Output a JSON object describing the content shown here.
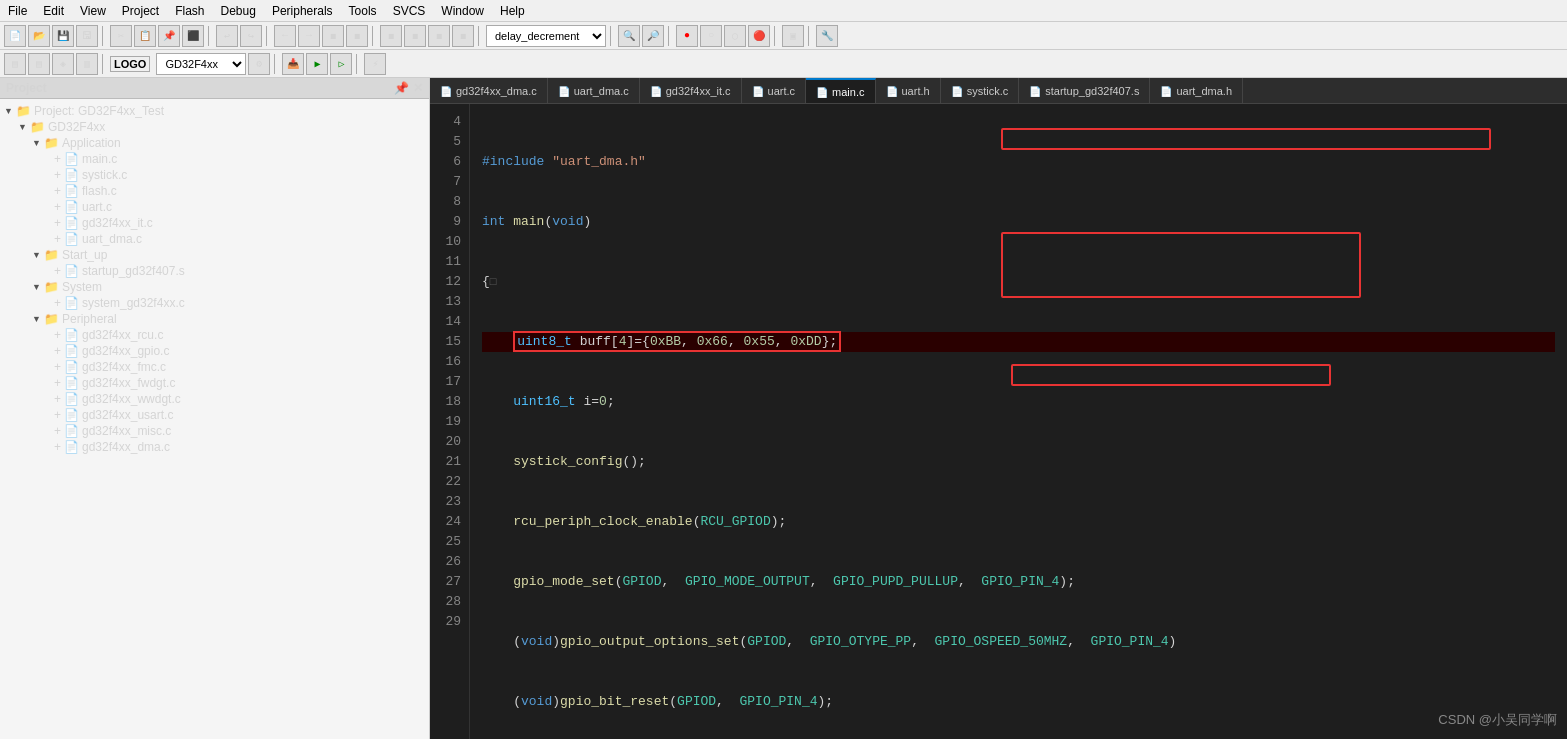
{
  "menubar": {
    "items": [
      "File",
      "Edit",
      "View",
      "Project",
      "Flash",
      "Debug",
      "Peripherals",
      "Tools",
      "SVCS",
      "Window",
      "Help"
    ]
  },
  "toolbar": {
    "dropdown1": "delay_decrement",
    "dropdown2": "GD32F4xx"
  },
  "project": {
    "title": "Project",
    "tree": [
      {
        "id": "project-root",
        "label": "Project: GD32F4xx_Test",
        "indent": 0,
        "type": "project",
        "expanded": true
      },
      {
        "id": "gd32f4xx",
        "label": "GD32F4xx",
        "indent": 1,
        "type": "folder",
        "expanded": true
      },
      {
        "id": "application",
        "label": "Application",
        "indent": 2,
        "type": "folder",
        "expanded": true
      },
      {
        "id": "main-c",
        "label": "main.c",
        "indent": 3,
        "type": "file"
      },
      {
        "id": "systick-c",
        "label": "systick.c",
        "indent": 3,
        "type": "file"
      },
      {
        "id": "flash-c",
        "label": "flash.c",
        "indent": 3,
        "type": "file"
      },
      {
        "id": "uart-c",
        "label": "uart.c",
        "indent": 3,
        "type": "file"
      },
      {
        "id": "gd32f4xx-it-c",
        "label": "gd32f4xx_it.c",
        "indent": 3,
        "type": "file"
      },
      {
        "id": "uart-dma-c",
        "label": "uart_dma.c",
        "indent": 3,
        "type": "file"
      },
      {
        "id": "startup",
        "label": "Start_up",
        "indent": 2,
        "type": "folder",
        "expanded": true
      },
      {
        "id": "startup-s",
        "label": "startup_gd32f407.s",
        "indent": 3,
        "type": "file"
      },
      {
        "id": "system",
        "label": "System",
        "indent": 2,
        "type": "folder",
        "expanded": true
      },
      {
        "id": "system-gd32",
        "label": "system_gd32f4xx.c",
        "indent": 3,
        "type": "file"
      },
      {
        "id": "peripheral",
        "label": "Peripheral",
        "indent": 2,
        "type": "folder",
        "expanded": true
      },
      {
        "id": "rcu-c",
        "label": "gd32f4xx_rcu.c",
        "indent": 3,
        "type": "file"
      },
      {
        "id": "gpio-c",
        "label": "gd32f4xx_gpio.c",
        "indent": 3,
        "type": "file"
      },
      {
        "id": "fmc-c",
        "label": "gd32f4xx_fmc.c",
        "indent": 3,
        "type": "file"
      },
      {
        "id": "fwdgt-c",
        "label": "gd32f4xx_fwdgt.c",
        "indent": 3,
        "type": "file"
      },
      {
        "id": "wwdgt-c",
        "label": "gd32f4xx_wwdgt.c",
        "indent": 3,
        "type": "file"
      },
      {
        "id": "usart-c",
        "label": "gd32f4xx_usart.c",
        "indent": 3,
        "type": "file"
      },
      {
        "id": "misc-c",
        "label": "gd32f4xx_misc.c",
        "indent": 3,
        "type": "file"
      },
      {
        "id": "dma-c",
        "label": "gd32f4xx_dma.c",
        "indent": 3,
        "type": "file"
      }
    ]
  },
  "tabs": [
    {
      "label": "gd32f4xx_dma.c",
      "active": false
    },
    {
      "label": "uart_dma.c",
      "active": false
    },
    {
      "label": "gd32f4xx_it.c",
      "active": false
    },
    {
      "label": "uart.c",
      "active": false
    },
    {
      "label": "main.c",
      "active": true
    },
    {
      "label": "uart.h",
      "active": false
    },
    {
      "label": "systick.c",
      "active": false
    },
    {
      "label": "startup_gd32f407.s",
      "active": false
    },
    {
      "label": "uart_dma.h",
      "active": false
    }
  ],
  "lines": [
    4,
    5,
    6,
    7,
    8,
    9,
    10,
    11,
    12,
    13,
    14,
    15,
    16,
    17,
    18,
    19,
    20,
    21,
    22,
    23,
    24,
    25,
    26,
    27,
    28,
    29
  ],
  "watermark": "CSDN @小吴同学啊"
}
